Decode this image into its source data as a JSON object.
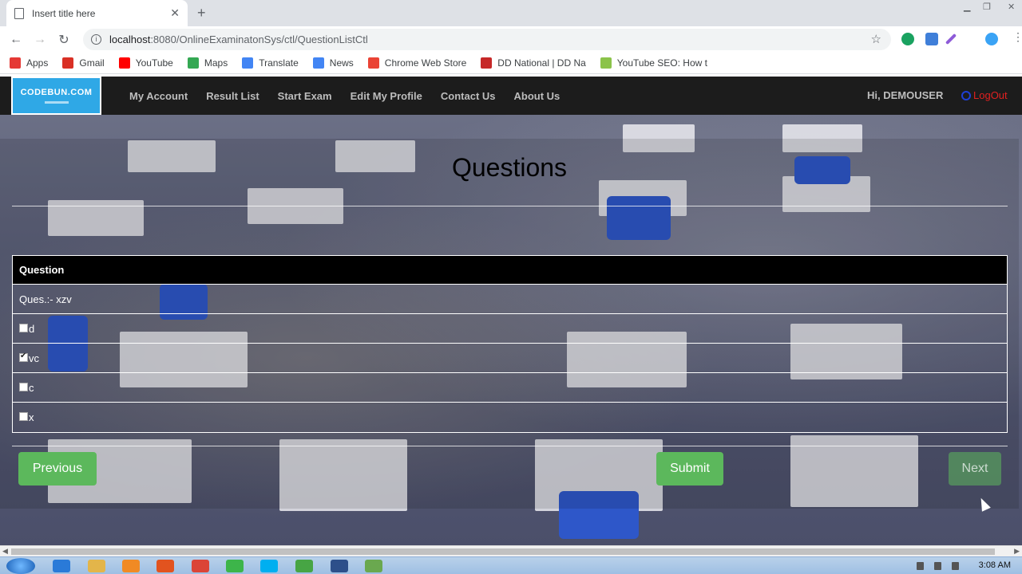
{
  "browser": {
    "tab_title": "Insert title here",
    "url_host": "localhost",
    "url_path": ":8080/OnlineExaminatonSys/ctl/QuestionListCtl",
    "bookmarks": [
      {
        "label": "Apps",
        "icon": "apps-grid-icon",
        "color": "#e53935"
      },
      {
        "label": "Gmail",
        "icon": "gmail-icon",
        "color": "#d93025"
      },
      {
        "label": "YouTube",
        "icon": "youtube-icon",
        "color": "#ff0000"
      },
      {
        "label": "Maps",
        "icon": "maps-icon",
        "color": "#34a853"
      },
      {
        "label": "Translate",
        "icon": "translate-icon",
        "color": "#4285f4"
      },
      {
        "label": "News",
        "icon": "news-icon",
        "color": "#4285f4"
      },
      {
        "label": "Chrome Web Store",
        "icon": "webstore-icon",
        "color": "#ea4335"
      },
      {
        "label": "DD National | DD Na",
        "icon": "dd-icon",
        "color": "#c62828"
      },
      {
        "label": "YouTube SEO: How t",
        "icon": "seo-icon",
        "color": "#8bc34a"
      }
    ]
  },
  "nav": {
    "logo_text": "CODEBUN.COM",
    "menu": [
      "My Account",
      "Result List",
      "Start Exam",
      "Edit My Profile",
      "Contact Us",
      "About Us"
    ],
    "greeting": "Hi, DEMOUSER",
    "logout": "LogOut"
  },
  "page": {
    "heading": "Questions",
    "table_header": "Question",
    "question_text": "Ques.:- xzv",
    "options": [
      {
        "label": "d",
        "checked": false
      },
      {
        "label": "vc",
        "checked": true
      },
      {
        "label": "c",
        "checked": false
      },
      {
        "label": "x",
        "checked": false
      }
    ],
    "buttons": {
      "previous": "Previous",
      "submit": "Submit",
      "next": "Next"
    },
    "accent_color": "#5cb85c"
  },
  "taskbar": {
    "clock": "3:08 AM"
  }
}
